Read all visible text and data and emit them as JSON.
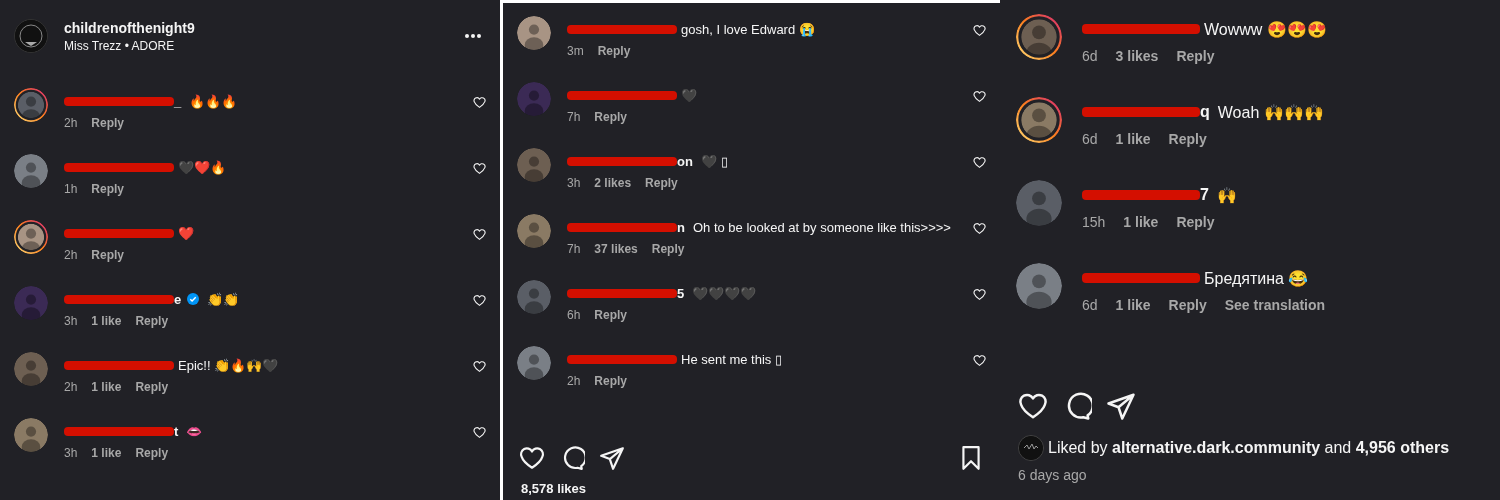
{
  "panels": [
    {
      "header": {
        "account": "childrenofthenight9",
        "subtitle": "Miss Trezz • ADORE"
      },
      "kind": "normal",
      "comment_hearts": true,
      "comments": [
        {
          "name_tail": "_",
          "text": "🔥🔥🔥",
          "time": "2h",
          "reply": "Reply",
          "story_ring": true
        },
        {
          "text": "🖤❤️🔥",
          "time": "1h",
          "reply": "Reply",
          "story_ring": false
        },
        {
          "text": "❤️",
          "time": "2h",
          "reply": "Reply",
          "story_ring": true
        },
        {
          "name_tail": "e",
          "verified": true,
          "text": "👏👏",
          "time": "3h",
          "likes": "1 like",
          "reply": "Reply",
          "story_ring": false
        },
        {
          "text": "Epic!! 👏🔥🙌🖤",
          "time": "2h",
          "likes": "1 like",
          "reply": "Reply",
          "story_ring": false
        },
        {
          "name_tail": "t",
          "text": "👄",
          "time": "3h",
          "likes": "1 like",
          "reply": "Reply",
          "story_ring": false
        }
      ]
    },
    {
      "kind": "normal",
      "comment_hearts": true,
      "comments": [
        {
          "text": "gosh, I love Edward 😭",
          "time": "3m",
          "reply": "Reply",
          "story_ring": false
        },
        {
          "text": "🖤",
          "time": "7h",
          "reply": "Reply",
          "story_ring": false
        },
        {
          "name_tail": "on",
          "text": "🖤 ▯",
          "time": "3h",
          "likes": "2 likes",
          "reply": "Reply",
          "story_ring": false
        },
        {
          "name_tail": "n",
          "text": "Oh to be looked at by someone like this>>>>",
          "time": "7h",
          "likes": "37 likes",
          "reply": "Reply",
          "story_ring": false
        },
        {
          "name_tail": "5",
          "text": "🖤🖤🖤🖤",
          "time": "6h",
          "reply": "Reply",
          "story_ring": false
        },
        {
          "text": "He sent me this ▯",
          "time": "2h",
          "reply": "Reply",
          "story_ring": false
        }
      ],
      "actions": {
        "bookmark": true
      },
      "likes": "8,578 likes"
    },
    {
      "kind": "large",
      "comment_hearts": false,
      "comments": [
        {
          "text": "Wowww 😍😍😍",
          "time": "6d",
          "likes": "3 likes",
          "reply": "Reply",
          "story_ring": true
        },
        {
          "name_tail": "q",
          "text": "Woah 🙌🙌🙌",
          "time": "6d",
          "likes": "1 like",
          "reply": "Reply",
          "story_ring": true
        },
        {
          "name_tail": "7",
          "text": "🙌",
          "time": "15h",
          "likes": "1 like",
          "reply": "Reply",
          "story_ring": false
        },
        {
          "text": "Бредятина 😂",
          "time": "6d",
          "likes": "1 like",
          "reply": "Reply",
          "translate": "See translation",
          "story_ring": false
        }
      ],
      "actions": {
        "bookmark": false
      },
      "liked_by": {
        "prefix": "Liked by",
        "account": "alternative.dark.community",
        "middle": "and",
        "others": "4,956 others"
      },
      "date": "6 days ago"
    }
  ]
}
